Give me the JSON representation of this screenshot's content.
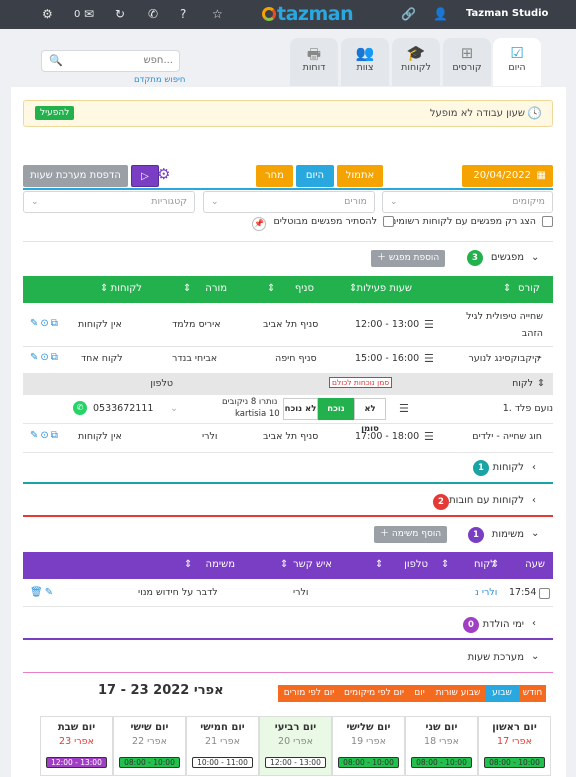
{
  "topbar": {
    "brand": "Tazman Studio",
    "logo": "tazman",
    "mail_count": "0",
    "icons": [
      "gear-icon",
      "mail-icon",
      "refresh-icon",
      "phone-icon",
      "help-icon",
      "star-icon",
      "link-icon",
      "user-icon"
    ]
  },
  "nav_tabs": [
    {
      "label": "היום",
      "icon": "checkbox-icon",
      "active": true
    },
    {
      "label": "קורסים",
      "icon": "hierarchy-icon"
    },
    {
      "label": "לקוחות",
      "icon": "graduation-icon"
    },
    {
      "label": "צוות",
      "icon": "team-icon"
    },
    {
      "label": "דוחות",
      "icon": "printer-icon"
    }
  ],
  "search": {
    "placeholder": "חפש...",
    "advanced": "חיפוש מתקדם"
  },
  "warning": {
    "text": "שעון עבודה לא מופעל",
    "button": "להפעיל"
  },
  "controls": {
    "date": "20/04/2022",
    "yesterday": "אתמול",
    "today": "היום",
    "tomorrow": "מחר",
    "print_hours": "הדפסת מערכת שעות",
    "locations_placeholder": "מיקומים",
    "teachers_placeholder": "מורים",
    "categories_placeholder": "קטגוריות",
    "only_registered": "הצג רק מפגשים עם לקוחות רשומים",
    "hide_canceled": "להסתיר מפגשים מבוטלים"
  },
  "meetings": {
    "title": "מפגשים",
    "count": "3",
    "add_button": "הוספת מפגש",
    "headers": {
      "course": "קורס",
      "hours": "שעות פעילות",
      "branch": "סניף",
      "teacher": "מורה",
      "clients": "לקוחות"
    },
    "rows": [
      {
        "course": "שחייה טיפולית לגיל הזהב",
        "hours": "12:00 - 13:00",
        "branch": "סניף תל אביב",
        "teacher": "איריס מלמד",
        "clients": "אין לקוחות"
      },
      {
        "course": "קיקבוקסינג לנוער",
        "hours": "15:00 - 16:00",
        "branch": "סניף חיפה",
        "teacher": "אביחי בנדר",
        "clients": "לקוח אחד"
      },
      {
        "course": "חוג שחייה - ילדים",
        "hours": "17:00 - 18:00",
        "branch": "סניף תל אביב",
        "teacher": "ולרי",
        "clients": "אין לקוחות"
      }
    ],
    "sub": {
      "client_header": "לקוח",
      "phone_header": "טלפון",
      "mark_all": "סמן נוכחות לכולם",
      "client_name": "1. נועם פלד",
      "present": "נוכח",
      "absent": "לא נוכח",
      "not_marked": "לא סומן",
      "punches_line1": "נותרו 8 ניקובים",
      "punches_line2": "kartisia 10",
      "phone": "0533672111"
    }
  },
  "clients_section": {
    "title": "לקוחות",
    "count": "1"
  },
  "debt_section": {
    "title": "לקוחות עם חובות",
    "count": "2"
  },
  "tasks": {
    "title": "משימות",
    "count": "1",
    "add_button": "הוסף משימה",
    "headers": {
      "hour": "שעה",
      "client": "לקוח",
      "phone": "טלפון",
      "contact": "איש קשר",
      "task": "משימה"
    },
    "row": {
      "hour": "17:54",
      "client": "ולרי נ",
      "contact": "ולרי",
      "task": "לדבר על חידוש מנוי"
    }
  },
  "birthdays": {
    "title": "ימי הולדת",
    "count": "0"
  },
  "schedule": {
    "title": "מערכת שעות",
    "range": "17 - 23 אפרי 2022",
    "view_tabs": [
      "חודש",
      "שבוע",
      "שבוע שורות",
      "יום",
      "יום לפי מיקומים",
      "יום לפי מורים"
    ],
    "days": [
      {
        "name": "יום ראשון",
        "date": "אפרי 17",
        "event": "08:00 - 10:00"
      },
      {
        "name": "יום שני",
        "date": "אפרי 18",
        "event": "08:00 - 10:00"
      },
      {
        "name": "יום שלישי",
        "date": "אפרי 19",
        "event": "08:00 - 10:00"
      },
      {
        "name": "יום רביעי",
        "date": "אפרי 20",
        "event": "12:00 - 13:00"
      },
      {
        "name": "יום חמישי",
        "date": "אפרי 21",
        "event": "10:00 - 11:00"
      },
      {
        "name": "יום שישי",
        "date": "אפרי 22",
        "event": "08:00 - 10:00"
      },
      {
        "name": "יום שבת",
        "date": "אפרי 23",
        "event": "12:00 - 13:00"
      }
    ]
  },
  "colors": {
    "green": "#22b14c",
    "orange": "#f4a300",
    "blue": "#29a8e0",
    "purple": "#7a3ec4",
    "red": "#e53935",
    "teal": "#1aa3a3"
  }
}
